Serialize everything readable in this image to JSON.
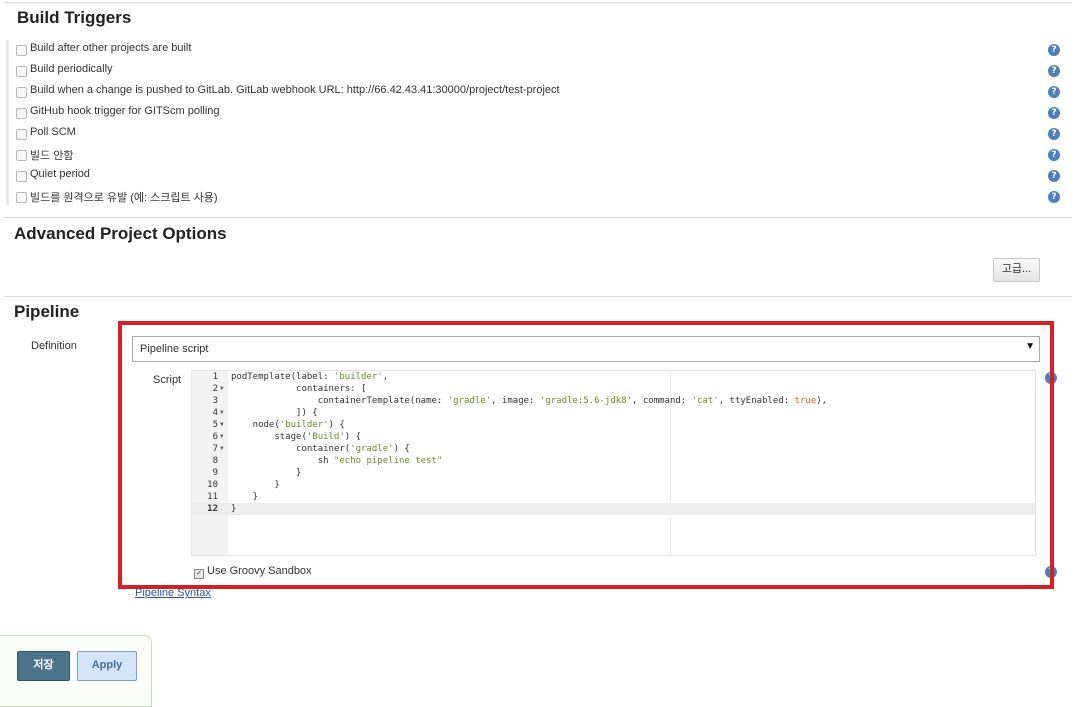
{
  "build_triggers": {
    "title": "Build Triggers",
    "items": [
      {
        "label": "Build after other projects are built",
        "checked": false
      },
      {
        "label": "Build periodically",
        "checked": false
      },
      {
        "label": "Build when a change is pushed to GitLab. GitLab webhook URL: http://66.42.43.41:30000/project/test-project",
        "checked": false
      },
      {
        "label": "GitHub hook trigger for GITScm polling",
        "checked": false
      },
      {
        "label": "Poll SCM",
        "checked": false
      },
      {
        "label": "빌드 안함",
        "checked": false
      },
      {
        "label": "Quiet period",
        "checked": false
      },
      {
        "label": "빌드를 원격으로 유발 (예: 스크립트 사용)",
        "checked": false
      }
    ],
    "help_glyph": "?"
  },
  "advanced": {
    "title": "Advanced Project Options",
    "button_label": "고급..."
  },
  "pipeline": {
    "title": "Pipeline",
    "definition_label": "Definition",
    "definition_value": "Pipeline script",
    "select_arrow": "▼",
    "script_label": "Script",
    "line_numbers": [
      "1",
      "2",
      "3",
      "4",
      "5",
      "6",
      "7",
      "8",
      "9",
      "10",
      "11",
      "12"
    ],
    "code_lines": [
      "podTemplate(label: 'builder',",
      "            containers: [",
      "                containerTemplate(name: 'gradle', image: 'gradle:5.6-jdk8', command: 'cat', ttyEnabled: true),",
      "            ]) {",
      "    node('builder') {",
      "        stage('Build') {",
      "            container('gradle') {",
      "                sh \"echo pipeline test\"",
      "            }",
      "        }",
      "    }",
      "}"
    ],
    "active_line": 12,
    "sandbox_label": "Use Groovy Sandbox",
    "sandbox_checked": true,
    "syntax_link": "Pipeline Syntax"
  },
  "footer": {
    "save_label": "저장",
    "apply_label": "Apply"
  },
  "colors": {
    "highlight_border": "#d81e23",
    "help_icon": "#4a7fc0",
    "save_button": "#4b758b",
    "apply_button": "#d4e5f7",
    "string": "#6a8a1d",
    "keyword": "#d1611e"
  }
}
